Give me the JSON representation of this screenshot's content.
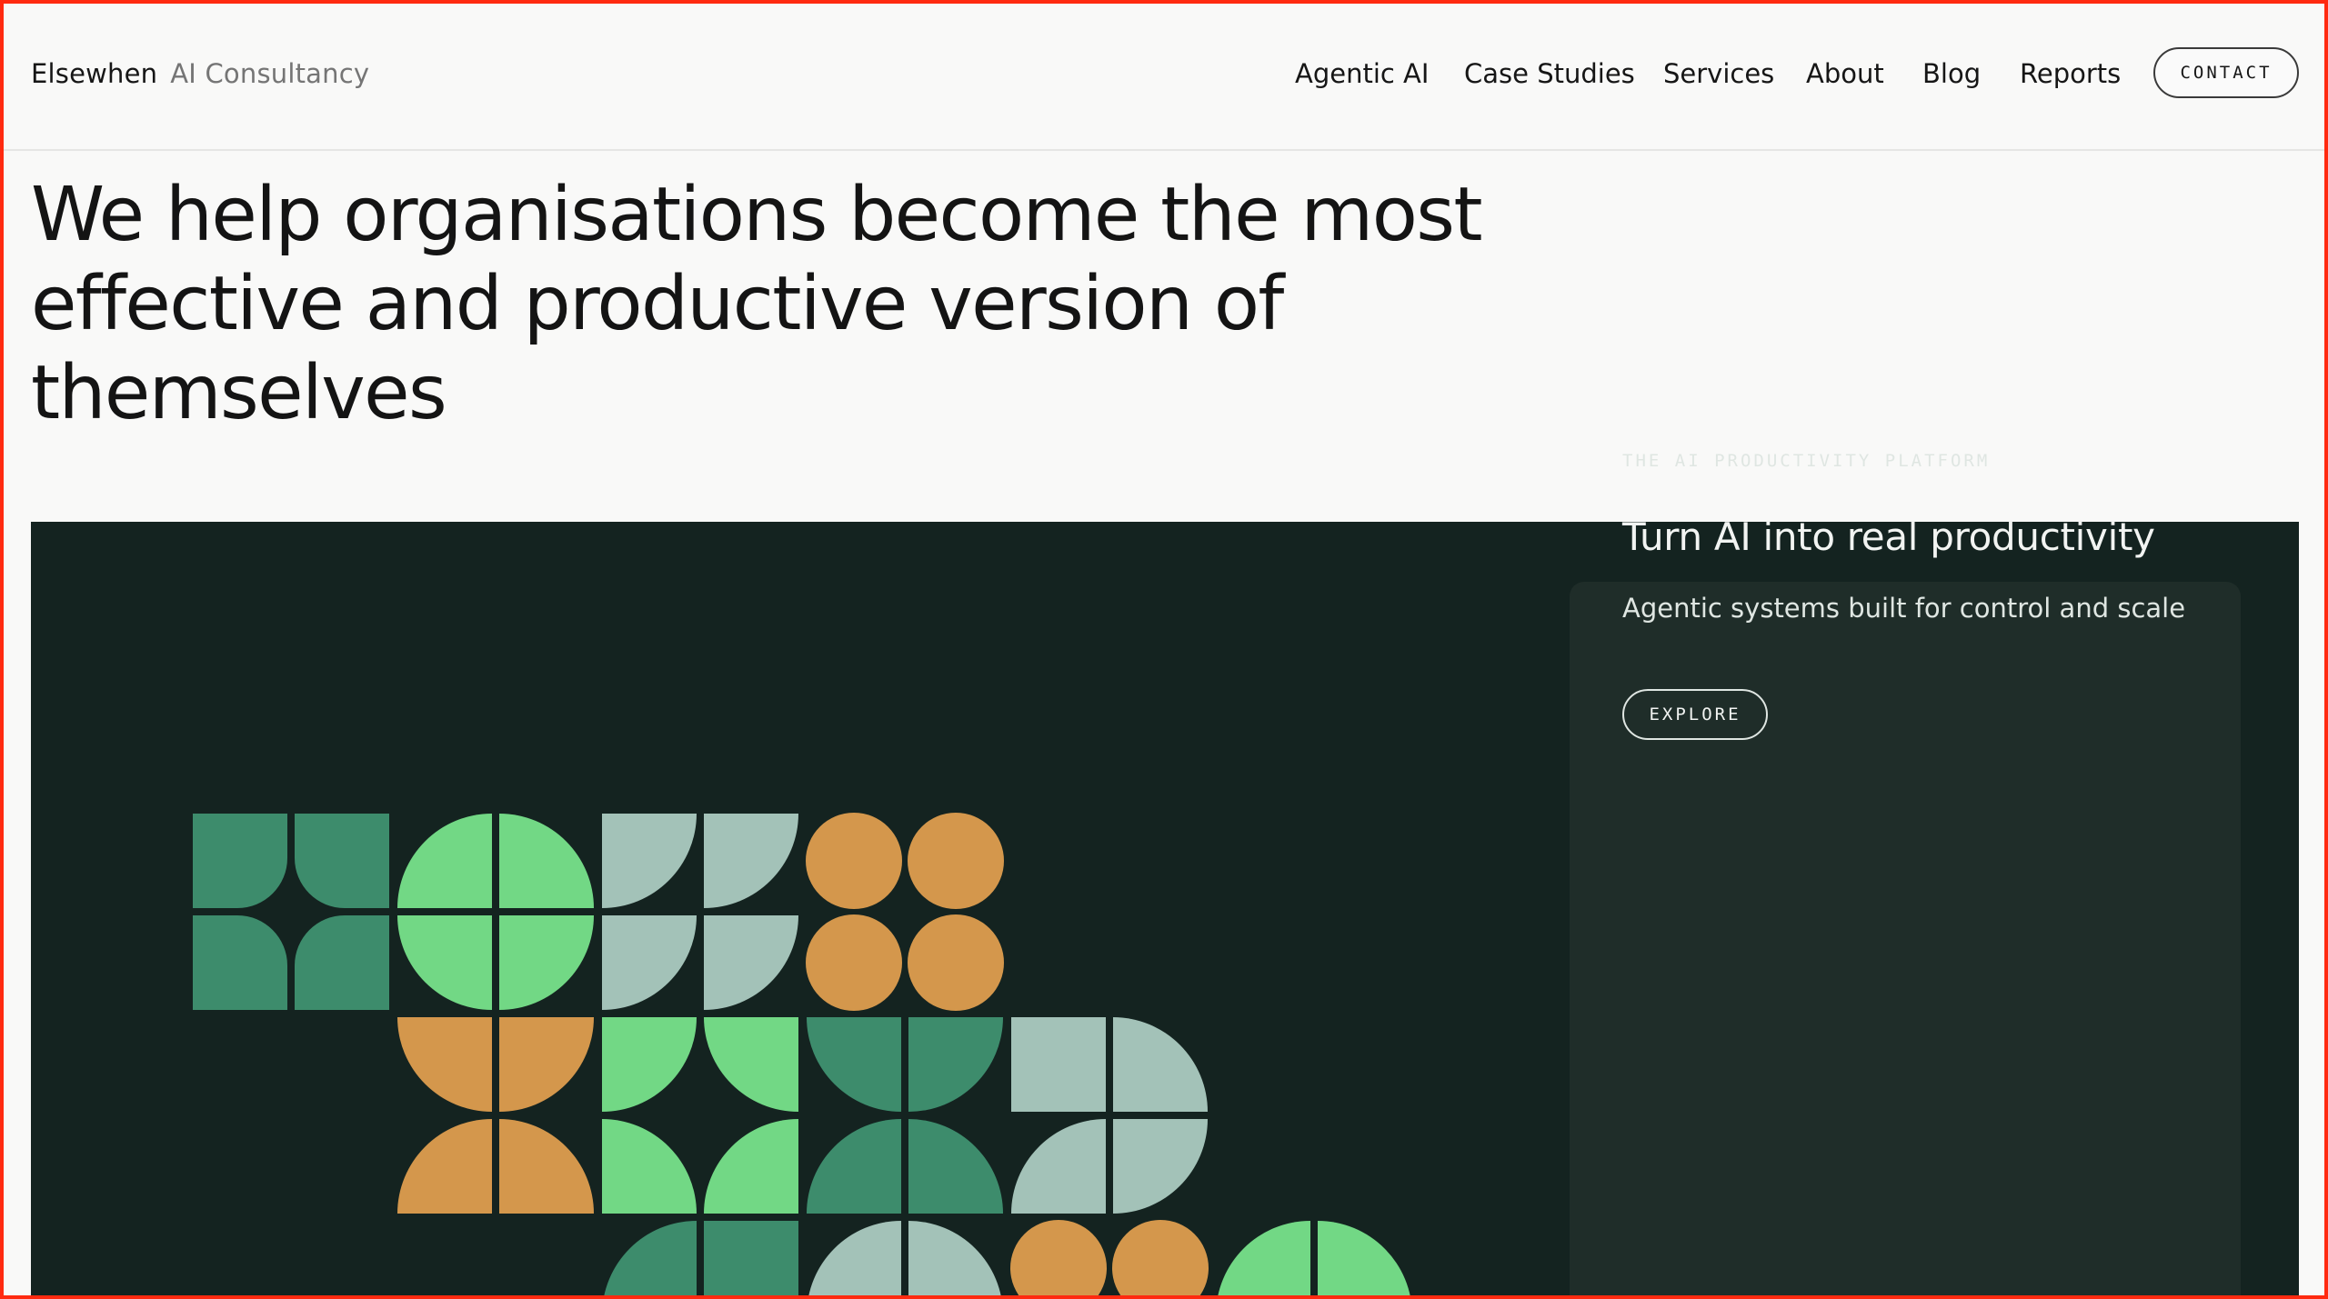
{
  "brand": {
    "name": "Elsewhen",
    "tagline": "AI Consultancy"
  },
  "nav": {
    "items": [
      "Agentic AI",
      "Case Studies",
      "Services",
      "About",
      "Blog",
      "Reports"
    ],
    "contact_label": "CONTACT"
  },
  "hero": {
    "headline_line1": "We help organisations become the most",
    "headline_line2": "effective and productive version of themselves"
  },
  "card": {
    "eyebrow": "THE AI PRODUCTIVITY PLATFORM",
    "title": "Turn AI into real productivity",
    "subtitle": "Agentic systems built for control and scale",
    "button_label": "EXPLORE"
  },
  "colors": {
    "page_bg": "#f9f9f8",
    "hero_bg": "#142320",
    "card_bg": "#1f2d29",
    "tile_dark_green": "#3d8c6c",
    "tile_light_green": "#72d885",
    "tile_sage": "#a3c2b8",
    "tile_orange": "#d4974c",
    "highlight_frame": "#ff2a10"
  }
}
